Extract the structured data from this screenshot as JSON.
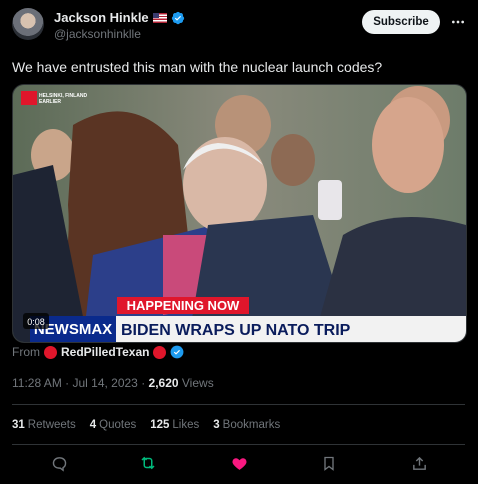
{
  "author": {
    "name": "Jackson Hinkle",
    "handle": "@jacksonhinklle",
    "flag_icon": "us-flag-icon",
    "verified_icon": "verified-badge-icon"
  },
  "header": {
    "subscribe_label": "Subscribe"
  },
  "tweet": {
    "text": "We have entrusted this man with the nuclear launch codes?"
  },
  "media": {
    "dateline": "HELSINKI, FINLAND",
    "dateline2": "EARLIER",
    "banner_top": "HAPPENING NOW",
    "channel": "NEWSMAX",
    "headline": "BIDEN WRAPS UP NATO TRIP",
    "duration": "0:08"
  },
  "source": {
    "prefix": "From",
    "name": "RedPilledTexan"
  },
  "meta": {
    "time": "11:28 AM · Jul 14, 2023 · ",
    "views_count": "2,620",
    "views_label": " Views"
  },
  "stats": {
    "retweets_count": "31",
    "retweets_label": "Retweets",
    "quotes_count": "4",
    "quotes_label": "Quotes",
    "likes_count": "125",
    "likes_label": "Likes",
    "bookmarks_count": "3",
    "bookmarks_label": "Bookmarks"
  },
  "colors": {
    "accent_blue": "#1d9bf0",
    "retweet_green": "#00ba7c",
    "like_pink": "#f91880",
    "newsmax_blue": "#0a2a8c",
    "banner_red": "#e0162b"
  }
}
